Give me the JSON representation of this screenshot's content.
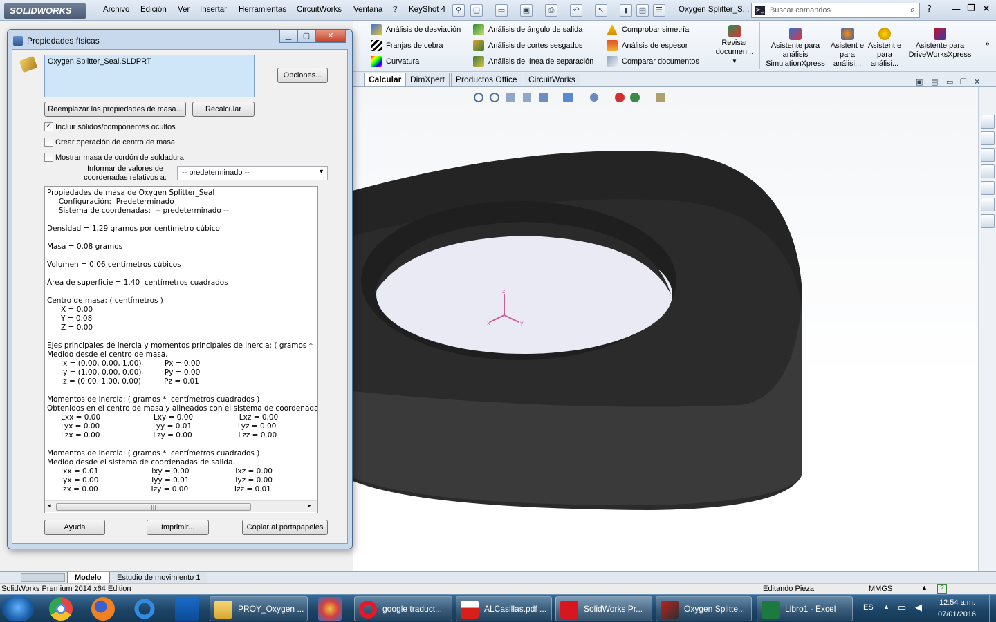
{
  "app": {
    "brand": "SOLIDWORKS",
    "doc_title": "Oxygen Splitter_S...",
    "search_placeholder": "Buscar comandos"
  },
  "menu": [
    "Archivo",
    "Edición",
    "Ver",
    "Insertar",
    "Herramientas",
    "CircuitWorks",
    "Ventana",
    "?",
    "KeyShot 4"
  ],
  "commands": {
    "col1": [
      "Análisis de desviación",
      "Franjas de cebra",
      "Curvatura"
    ],
    "col2": [
      "Análisis de ángulo de salida",
      "Análisis de cortes sesgados",
      "Análisis de línea de separación"
    ],
    "col3": [
      "Comprobar simetría",
      "Análisis de espesor",
      "Comparar documentos"
    ],
    "revisar": "Revisar documen...",
    "big": [
      "Asistente para análisis SimulationXpress",
      "Asistent e para análisi...",
      "Asistent e para análisi...",
      "Asistente para DriveWorksXpress"
    ]
  },
  "tabs": [
    "Calcular",
    "DimXpert",
    "Productos Office",
    "CircuitWorks"
  ],
  "dialog": {
    "title": "Propiedades físicas",
    "filename": "Oxygen Splitter_Seal.SLDPRT",
    "options_btn": "Opciones...",
    "replace_btn": "Reemplazar las propiedades de masa...",
    "recalc_btn": "Recalcular",
    "chk_hidden": "Incluir sólidos/componentes ocultos",
    "chk_hidden_checked": true,
    "chk_center": "Crear operación de centro de masa",
    "chk_weld": "Mostrar masa de cordón de soldadura",
    "coord_label": "Informar de valores de coordenadas relativos a:",
    "coord_value": "-- predeterminado --",
    "results": "Propiedades de masa de Oxygen Splitter_Seal\n     Configuración:  Predeterminado\n     Sistema de coordenadas:  -- predeterminado --\n\nDensidad = 1.29 gramos por centímetro cúbico\n\nMasa = 0.08 gramos\n\nVolumen = 0.06 centímetros cúbicos\n\nÁrea de superficie = 1.40  centímetros cuadrados\n\nCentro de masa: ( centímetros )\n      X = 0.00\n      Y = 0.08\n      Z = 0.00\n\nEjes principales de inercia y momentos principales de inercia: ( gramos *  cen\nMedido desde el centro de masa.\n      Ix = (0.00, 0.00, 1.00)          Px = 0.00\n      Iy = (1.00, 0.00, 0.00)          Py = 0.00\n      Iz = (0.00, 1.00, 0.00)          Pz = 0.01\n\nMomentos de inercia: ( gramos *  centímetros cuadrados )\nObtenidos en el centro de masa y alineados con el sistema de coordenadas\n      Lxx = 0.00                       Lxy = 0.00                    Lxz = 0.00\n      Lyx = 0.00                       Lyy = 0.01                    Lyz = 0.00\n      Lzx = 0.00                       Lzy = 0.00                    Lzz = 0.00\n\nMomentos de inercia: ( gramos *  centímetros cuadrados )\nMedido desde el sistema de coordenadas de salida.\n      Ixx = 0.01                       Ixy = 0.00                    Ixz = 0.00\n      Iyx = 0.00                       Iyy = 0.01                    Iyz = 0.00\n      Izx = 0.00                       Izy = 0.00                    Izz = 0.01",
    "help_btn": "Ayuda",
    "print_btn": "Imprimir...",
    "copy_btn": "Copiar al portapapeles"
  },
  "bottom_tabs": [
    "Modelo",
    "Estudio de movimiento 1"
  ],
  "status": {
    "edition": "SolidWorks Premium 2014 x64 Edition",
    "mode": "Editando Pieza",
    "units": "MMGS"
  },
  "taskbar": {
    "items": [
      "PROY_Oxygen ...",
      "google traduct...",
      "ALCasillas.pdf ...",
      "SolidWorks Pr...",
      "Oxygen Splitte...",
      "Libro1 - Excel"
    ],
    "lang": "ES",
    "time": "12:54 a.m.",
    "date": "07/01/2016"
  },
  "colors": {
    "accent": "#1d4466",
    "part": "#2c2c2c",
    "dialog_frame": "#c8d9ee"
  }
}
